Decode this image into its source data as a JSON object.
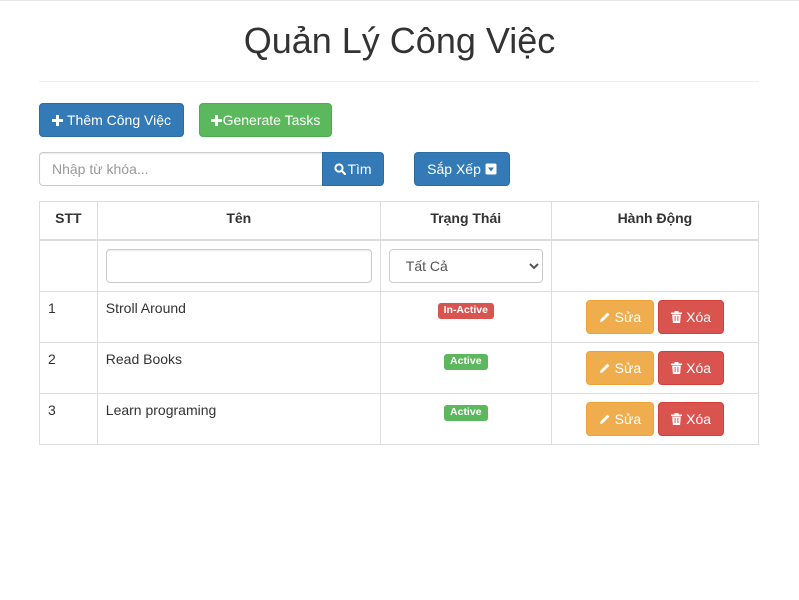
{
  "page": {
    "title": "Quản Lý Công Việc"
  },
  "toolbar": {
    "add_label": "Thêm Công Việc",
    "generate_label": "Generate Tasks"
  },
  "search": {
    "placeholder": "Nhập từ khóa...",
    "value": "",
    "button_label": "Tìm",
    "sort_label": "Sắp Xếp"
  },
  "table": {
    "headers": [
      "STT",
      "Tên",
      "Trạng Thái",
      "Hành Động"
    ],
    "filter": {
      "name_value": "",
      "status_selected": "Tất Cả"
    },
    "rows": [
      {
        "index": "1",
        "name": "Stroll Around",
        "status": "In-Active"
      },
      {
        "index": "2",
        "name": "Read Books",
        "status": "Active"
      },
      {
        "index": "3",
        "name": "Learn programing",
        "status": "Active"
      }
    ],
    "edit_label": "Sửa",
    "delete_label": "Xóa"
  },
  "colors": {
    "primary": "#337ab7",
    "success": "#5cb85c",
    "warning": "#f0ad4e",
    "danger": "#d9534f"
  },
  "icons": {
    "add": "plus-icon",
    "generate": "plus-icon",
    "search": "search-icon",
    "sort": "caret-square-down-icon",
    "edit": "pencil-icon",
    "delete": "trash-icon"
  }
}
